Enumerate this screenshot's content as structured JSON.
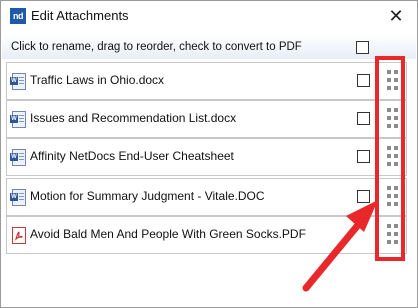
{
  "window": {
    "app_icon": "nd",
    "title": "Edit Attachments",
    "close_glyph": "✕"
  },
  "instructions": "Click to rename, drag to reorder, check to convert to PDF",
  "attachments": [
    {
      "name": "Traffic Laws in Ohio.docx",
      "icon": "word-doc-icon"
    },
    {
      "name": "Issues and Recommendation List.docx",
      "icon": "word-doc-icon"
    },
    {
      "name": "Affinity NetDocs End-User Cheatsheet",
      "icon": "word-doc-icon"
    },
    {
      "name": "Motion for Summary Judgment - Vitale.DOC",
      "icon": "word-doc-icon"
    },
    {
      "name": "Avoid Bald Men And People With Green Socks.PDF",
      "icon": "pdf-icon"
    }
  ],
  "colors": {
    "annotation_red": "#e8282b",
    "grip": "#8c8c8c",
    "app_icon_bg": "#1e5aa8"
  }
}
